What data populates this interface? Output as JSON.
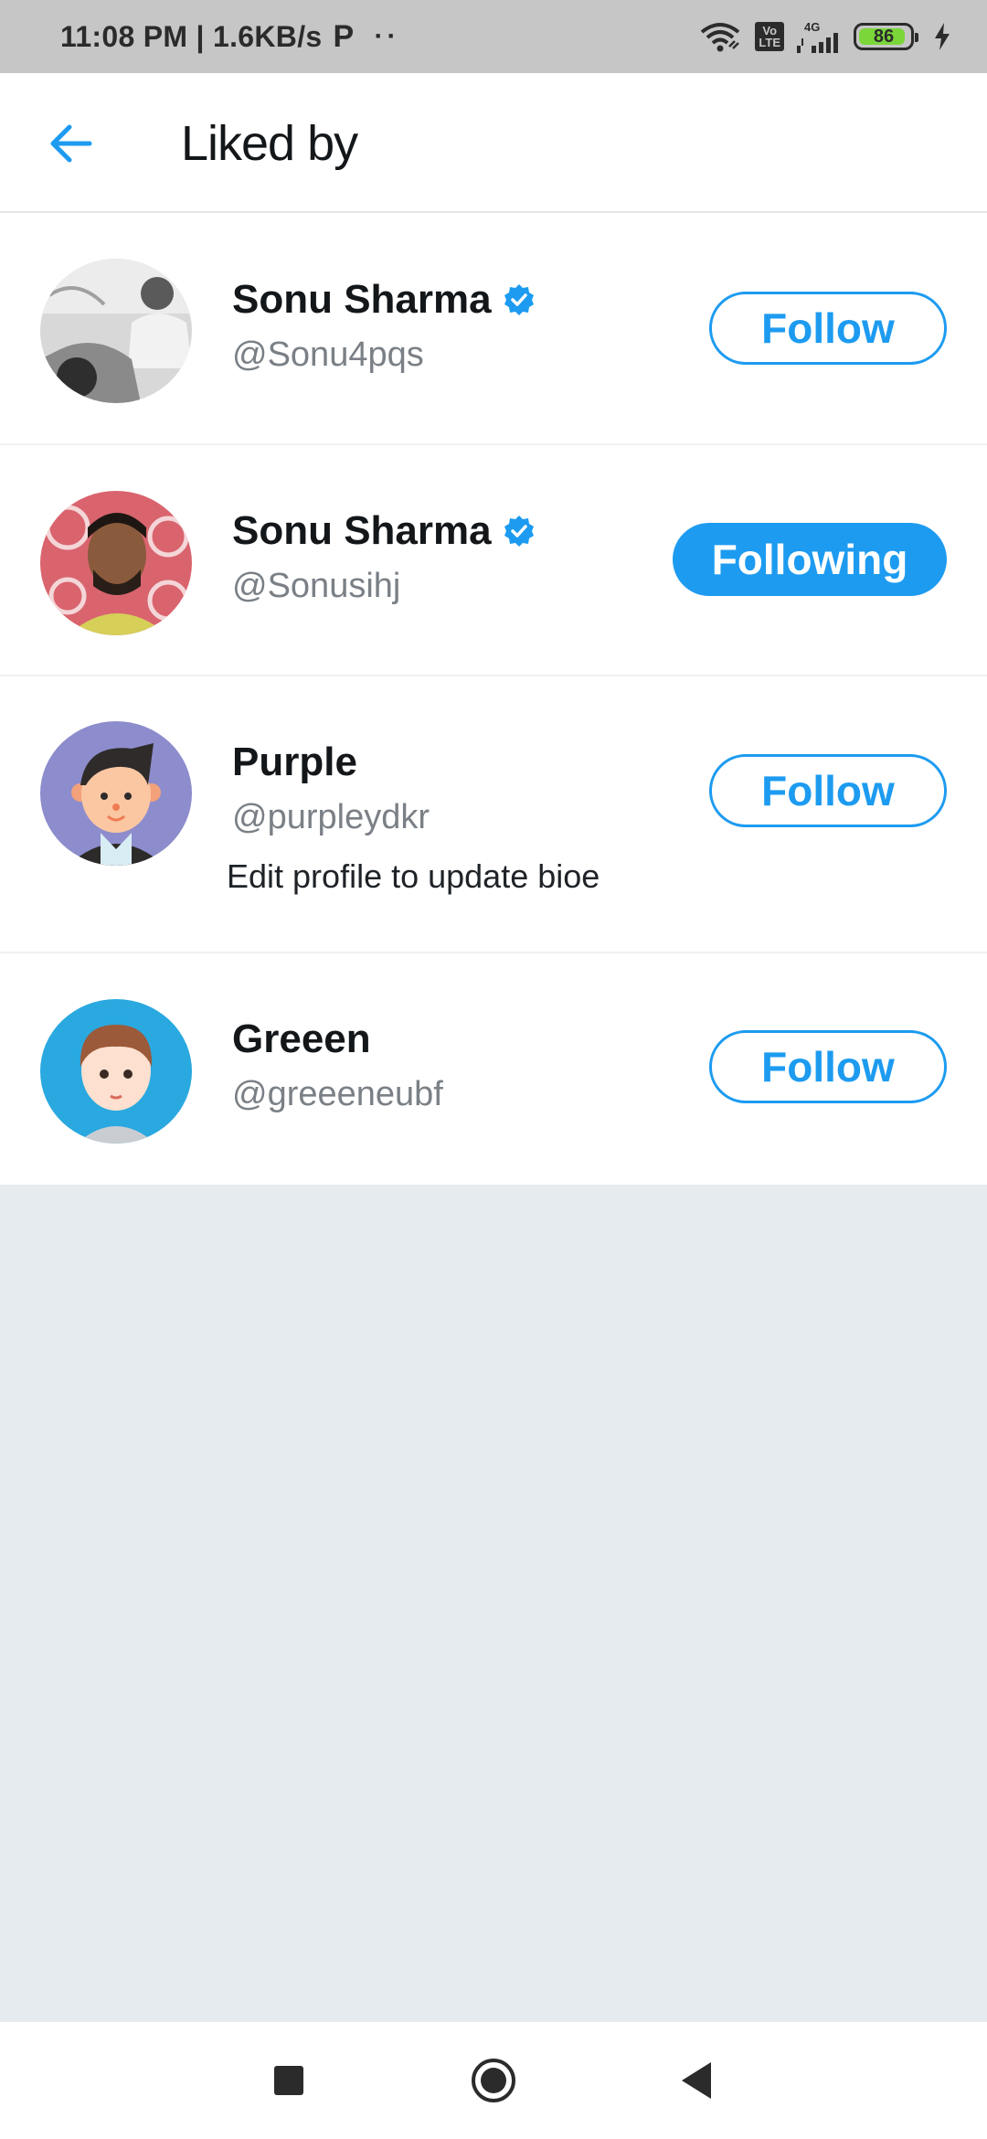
{
  "status_bar": {
    "time_speed": "11:08 PM | 1.6KB/s",
    "p_icon": "P",
    "dots": "··",
    "volte": [
      "Vo",
      "LTE"
    ],
    "network": "4G",
    "battery": "86"
  },
  "header": {
    "back_icon": "arrow-left-icon",
    "title": "Liked by"
  },
  "users": [
    {
      "name": "Sonu Sharma",
      "verified": true,
      "handle": "@Sonu4pqs",
      "bio": "",
      "button": "Follow",
      "following": false
    },
    {
      "name": "Sonu Sharma",
      "verified": true,
      "handle": "@Sonusihj",
      "bio": "",
      "button": "Following",
      "following": true
    },
    {
      "name": "Purple",
      "verified": false,
      "handle": "@purpleydkr",
      "bio": "Edit profile to update bioe",
      "button": "Follow",
      "following": false
    },
    {
      "name": "Greeen",
      "verified": false,
      "handle": "@greeeneubf",
      "bio": "",
      "button": "Follow",
      "following": false
    }
  ],
  "colors": {
    "accent": "#1d9bf0",
    "background": "#e6ebef",
    "status_bar": "#c6c6c6"
  },
  "navbar": {
    "items": [
      "recents-square-icon",
      "home-circle-icon",
      "back-triangle-icon"
    ]
  }
}
